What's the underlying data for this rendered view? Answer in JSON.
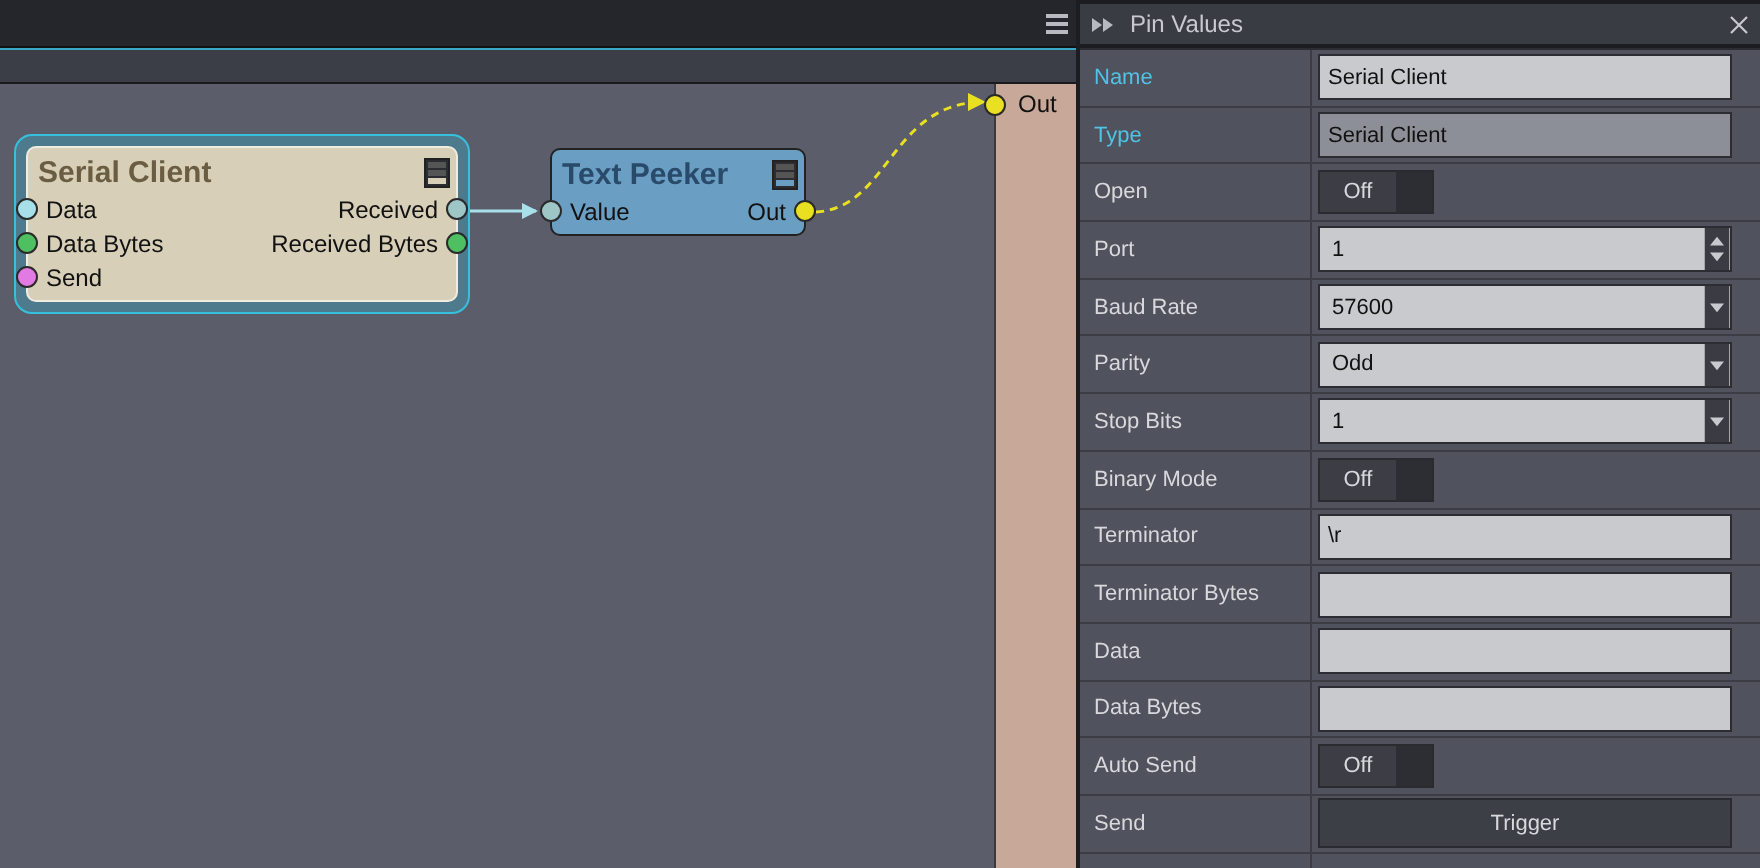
{
  "canvas": {
    "nodes": [
      {
        "title": "Serial Client",
        "selected": true,
        "color": "#d8cfb8",
        "inputs": [
          {
            "label": "Data",
            "color": "#a8e0ea"
          },
          {
            "label": "Data Bytes",
            "color": "#4fc062"
          },
          {
            "label": "Send",
            "color": "#e27ae4"
          }
        ],
        "outputs": [
          {
            "label": "Received",
            "color": "#9fc6c6"
          },
          {
            "label": "Received Bytes",
            "color": "#4fc062"
          }
        ]
      },
      {
        "title": "Text Peeker",
        "selected": false,
        "color": "#6b9ec3",
        "inputs": [
          {
            "label": "Value",
            "color": "#9fc6c6"
          }
        ],
        "outputs": [
          {
            "label": "Out",
            "color": "#e8e020"
          }
        ]
      }
    ],
    "exposed_pin": {
      "label": "Out",
      "color": "#e8e020"
    }
  },
  "panel": {
    "title": "Pin Values",
    "rows": [
      {
        "label": "Name",
        "highlighted": true,
        "kind": "text",
        "value": "Serial Client",
        "readonly": false
      },
      {
        "label": "Type",
        "highlighted": true,
        "kind": "text",
        "value": "Serial Client",
        "readonly": true
      },
      {
        "label": "Open",
        "highlighted": false,
        "kind": "toggle",
        "value": "Off",
        "on": false
      },
      {
        "label": "Port",
        "highlighted": false,
        "kind": "spin",
        "value": "1"
      },
      {
        "label": "Baud Rate",
        "highlighted": false,
        "kind": "select",
        "value": "57600"
      },
      {
        "label": "Parity",
        "highlighted": false,
        "kind": "select",
        "value": "Odd"
      },
      {
        "label": "Stop Bits",
        "highlighted": false,
        "kind": "select",
        "value": "1"
      },
      {
        "label": "Binary Mode",
        "highlighted": false,
        "kind": "toggle",
        "value": "Off",
        "on": false
      },
      {
        "label": "Terminator",
        "highlighted": false,
        "kind": "text",
        "value": "\\r",
        "readonly": false
      },
      {
        "label": "Terminator Bytes",
        "highlighted": false,
        "kind": "text",
        "readonly": false
      },
      {
        "label": "Data",
        "highlighted": false,
        "kind": "text",
        "readonly": false
      },
      {
        "label": "Data Bytes",
        "highlighted": false,
        "kind": "text",
        "readonly": false
      },
      {
        "label": "Auto Send",
        "highlighted": false,
        "kind": "toggle",
        "value": "Off",
        "on": false
      },
      {
        "label": "Send",
        "highlighted": false,
        "kind": "button",
        "value": "Trigger"
      }
    ]
  }
}
